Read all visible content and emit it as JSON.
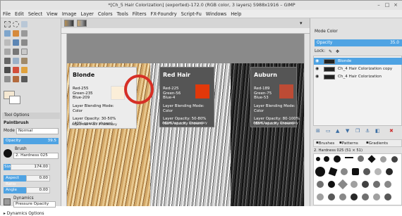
{
  "window": {
    "title": "*[Ch_5 Hair Colorization] (exported)-172.0 (RGB color, 3 layers) 5988x1916 – GIMP"
  },
  "menu": [
    "File",
    "Edit",
    "Select",
    "View",
    "Image",
    "Layer",
    "Colors",
    "Tools",
    "Filters",
    "FX-Foundry",
    "Script-Fu",
    "Windows",
    "Help"
  ],
  "tool_options": {
    "header": "Tool Options",
    "tool": "Paintbrush",
    "mode_label": "Mode",
    "mode_value": "Normal",
    "opacity_label": "Opacity",
    "opacity_value": "39.5",
    "brush_label": "Brush",
    "brush_value": "2. Hardness 025",
    "size_label": "Size",
    "size_value": "174.00",
    "aspect_label": "Aspect Ratio",
    "aspect_value": "0.00",
    "angle_label": "Angle",
    "angle_value": "0.00",
    "dynamics_label": "Dynamics",
    "dynamics_value": "Pressure Opacity",
    "dynamics_options": "Dynamics Options"
  },
  "cards": [
    {
      "title": "Blonde",
      "red": "Red-255",
      "green": "Green-235",
      "blue": "Blue-209",
      "swatch": "#fbeed8",
      "mode1": "Layer Blending Mode:",
      "mode2": "Color",
      "op1": "Layer Opacity: 30-50%",
      "op2": "(40% opacity shown)",
      "note": "Adjust hue + or - if necessary"
    },
    {
      "title": "Red Hair",
      "red": "Red-225",
      "green": "Green-56",
      "blue": "Blue-4",
      "swatch": "#e1380a",
      "mode1": "Layer Blending Mode:",
      "mode2": "Color",
      "op1": "Layer Opacity: 50-80%",
      "op2": "(60% opacity shown)",
      "note": "Adjust hue + or - if necessary"
    },
    {
      "title": "Auburn",
      "red": "Red-189",
      "green": "Green-75",
      "blue": "Blue-53",
      "swatch": "#bd4b35",
      "mode1": "Layer Blending Mode:",
      "mode2": "Color",
      "op1": "Layer Opacity: 80-100%",
      "op2": "(85% opacity shown)",
      "note": "Adjust hue + or - if necessary"
    }
  ],
  "layers_panel": {
    "mode_label": "Mode",
    "mode_value": "Color",
    "opacity_label": "Opacity",
    "opacity_value": "35.0",
    "lock_label": "Lock:",
    "layers": [
      {
        "name": "Blonde",
        "selected": true
      },
      {
        "name": "Ch_4 Hair Colorization copy",
        "selected": false
      },
      {
        "name": "Ch_4 Hair Colorization",
        "selected": false
      }
    ]
  },
  "brushes_panel": {
    "tabs": [
      "Brushes",
      "Patterns",
      "Gradients"
    ],
    "filter": "2. Hardness 025 (51 × 51)"
  },
  "colors": {
    "accent": "#4fa3e3",
    "ring": "#d62f25"
  }
}
